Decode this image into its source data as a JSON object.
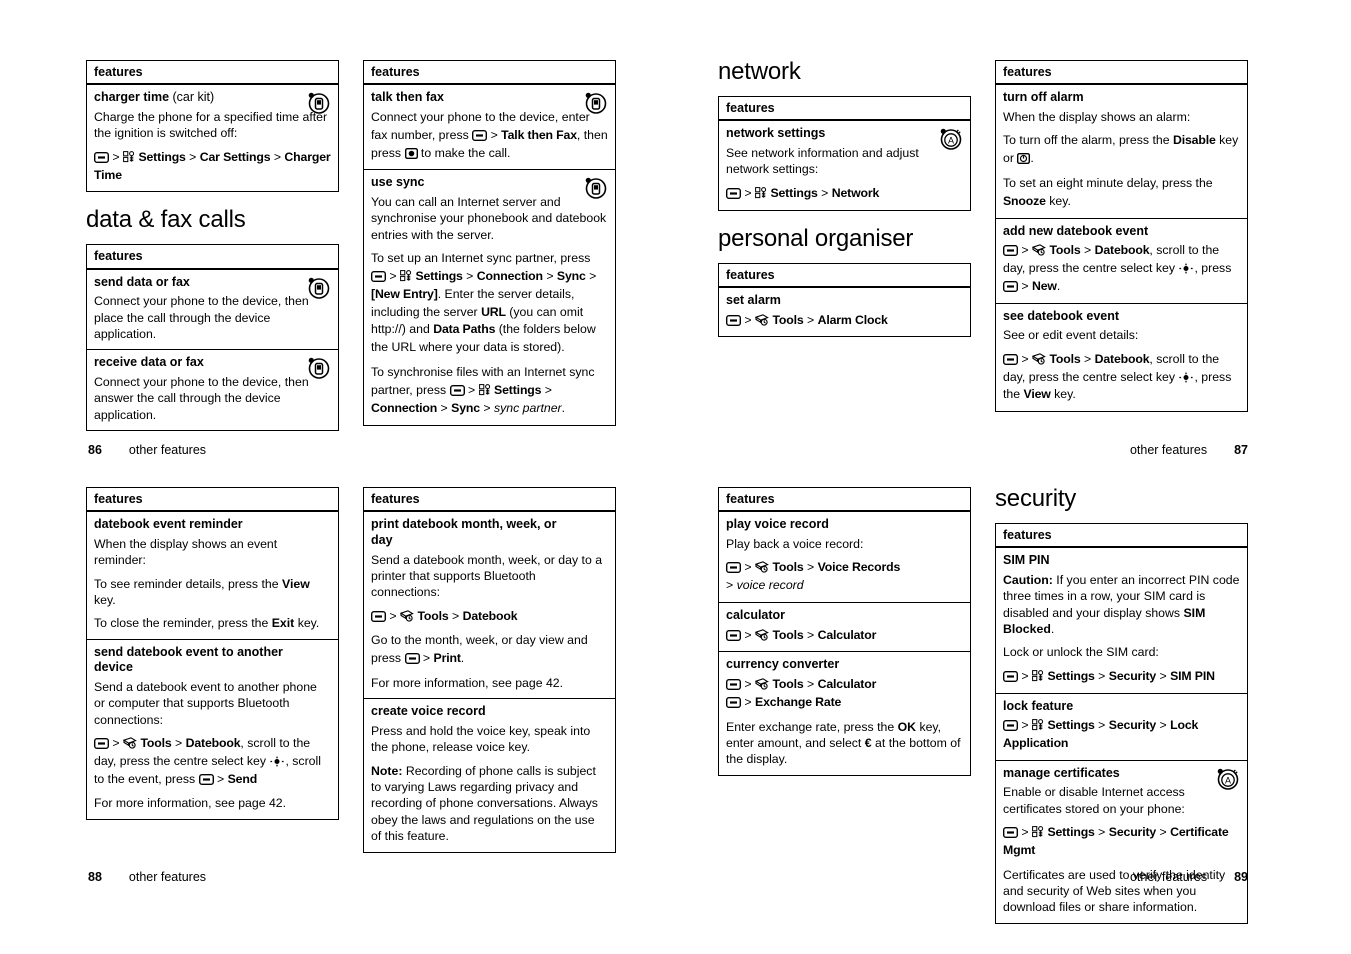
{
  "document": {
    "features_header": "features",
    "footer_label": "other features"
  },
  "pages": [
    {
      "id": "86",
      "number": "86",
      "label": "other features"
    },
    {
      "id": "87",
      "number": "87",
      "label": "other features"
    },
    {
      "id": "88",
      "number": "88",
      "label": "other features"
    },
    {
      "id": "89",
      "number": "89",
      "label": "other features"
    }
  ],
  "headings": {
    "data_fax_calls": "data & fax calls",
    "network": "network",
    "personal_organiser": "personal organiser",
    "security": "security"
  },
  "p86": {
    "table1": {
      "header": "features",
      "rows": [
        {
          "title_bold": "charger time",
          "title_plain": " (car kit)",
          "icon": "device-circle-icon",
          "body": [
            {
              "type": "para",
              "text": "Charge the phone for a specified time after the ignition is switched off:"
            },
            {
              "type": "path",
              "text": "MENUKEY > SETTINGSICON Settings > Car Settings > Charger Time"
            }
          ]
        }
      ]
    },
    "table2": {
      "header": "features",
      "rows": [
        {
          "title_bold": "send data or fax",
          "title_plain": "",
          "icon": "device-circle-icon",
          "body": [
            {
              "type": "para",
              "text": "Connect your phone to the device, then place the call through the device application."
            }
          ]
        },
        {
          "title_bold": "receive data or fax",
          "title_plain": "",
          "icon": "device-circle-icon",
          "body": [
            {
              "type": "para",
              "text": "Connect your phone to the device, then answer the call through the device application."
            }
          ]
        }
      ]
    }
  },
  "p86b": {
    "table": {
      "header": "features",
      "rows": [
        {
          "title_bold": "talk then fax",
          "icon": "device-circle-icon",
          "body_html": "Connect your phone to the device, enter fax number, press MENUKEY &gt; <b>Talk then Fax</b>, then press SENDKEY to make the call."
        },
        {
          "title_bold": "use sync",
          "icon": "device-circle-icon",
          "body_html": "You can call an Internet server and synchronise your phonebook and datebook entries with the server."
        }
      ]
    }
  },
  "p87": {
    "network_table": {
      "header": "features",
      "rows": [
        {
          "title_bold": "network settings",
          "icon": "antenna-a-circle-icon",
          "body": [
            {
              "type": "para",
              "text": "See network information and adjust network settings:"
            },
            {
              "type": "path",
              "text": "MENUKEY > SETTINGSICON Settings > Network"
            }
          ]
        }
      ]
    },
    "organiser_table": {
      "header": "features",
      "rows": [
        {
          "title_bold": "set alarm",
          "body": [
            {
              "type": "path",
              "text": "MENUKEY > TOOLSICON Tools > Alarm Clock"
            }
          ]
        }
      ]
    },
    "right_table": {
      "header": "features",
      "rows": [
        {
          "title_bold": "turn off alarm",
          "body": [
            {
              "type": "para",
              "text": "When the display shows an alarm:"
            },
            {
              "type": "para",
              "text": "To turn off the alarm, press the Disable key or POWERKEY."
            },
            {
              "type": "para",
              "text": "To set an eight minute delay, press the Snooze key."
            }
          ]
        },
        {
          "title_bold": "add new datebook event",
          "body": [
            {
              "type": "path",
              "text": "MENUKEY > TOOLSICON Tools > Datebook, scroll to the day, press the centre select key CENTREKEY, press MENUKEY > New."
            }
          ]
        },
        {
          "title_bold": "see datebook event",
          "body": [
            {
              "type": "para",
              "text": "See or edit event details:"
            },
            {
              "type": "path",
              "text": "MENUKEY > TOOLSICON Tools > Datebook, scroll to the day, press the centre select key CENTREKEY, press the View key."
            }
          ]
        }
      ]
    }
  },
  "p88": {
    "left_table": {
      "header": "features",
      "rows": [
        {
          "title_bold": "datebook event reminder",
          "body": [
            {
              "type": "para",
              "text": "When the display shows an event reminder:"
            },
            {
              "type": "para",
              "text": "To see reminder details, press the View key."
            },
            {
              "type": "para",
              "text": "To close the reminder, press the Exit key."
            }
          ]
        },
        {
          "title_bold": "send datebook event to another device",
          "body": [
            {
              "type": "para",
              "text": "Send a datebook event to another phone or computer that supports Bluetooth connections:"
            },
            {
              "type": "path",
              "text": "MENUKEY > TOOLSICON Tools > Datebook, scroll to the day, press the centre select key CENTREKEY, scroll to the event, press MENUKEY > Send"
            },
            {
              "type": "para",
              "text": "For more information, see page 42."
            }
          ]
        }
      ]
    },
    "right_table": {
      "header": "features",
      "rows": [
        {
          "title_bold": "print datebook month, week, or day",
          "body": [
            {
              "type": "para",
              "text": "Send a datebook month, week, or day to a printer that supports Bluetooth connections:"
            },
            {
              "type": "path",
              "text": "MENUKEY > TOOLSICON Tools > Datebook"
            },
            {
              "type": "para",
              "text": "Go to the month, week, or day view and press MENUKEY > Print."
            },
            {
              "type": "para",
              "text": "For more information, see page 42."
            }
          ]
        },
        {
          "title_bold": "create voice record",
          "body": [
            {
              "type": "para",
              "text": "Press and hold the voice key, speak into the phone, release voice key."
            },
            {
              "type": "para",
              "text": "Note: Recording of phone calls is subject to varying Laws regarding privacy and recording of phone conversations. Always obey the laws and regulations on the use of this feature."
            }
          ]
        }
      ]
    }
  },
  "p89": {
    "left_table": {
      "header": "features",
      "rows": [
        {
          "title_bold": "play voice record",
          "body": [
            {
              "type": "para",
              "text": "Play back a voice record:"
            },
            {
              "type": "path",
              "text": "MENUKEY > TOOLSICON Tools > Voice Records > voice record"
            }
          ]
        },
        {
          "title_bold": "calculator",
          "body": [
            {
              "type": "path",
              "text": "MENUKEY > TOOLSICON Tools > Calculator"
            }
          ]
        },
        {
          "title_bold": "currency converter",
          "body": [
            {
              "type": "path",
              "text": "MENUKEY > TOOLSICON Tools > Calculator MENUKEY > Exchange Rate"
            },
            {
              "type": "para",
              "text": "Enter exchange rate, press the OK key, enter amount, and select EUROGLYPH at the bottom of the display."
            }
          ]
        }
      ]
    },
    "right_table": {
      "header": "features",
      "rows": [
        {
          "title_bold": "SIM PIN",
          "body": [
            {
              "type": "para",
              "text": "Caution: If you enter an incorrect PIN code three times in a row, your SIM card is disabled and your display shows SIM Blocked."
            },
            {
              "type": "para",
              "text": "Lock or unlock the SIM card:"
            },
            {
              "type": "path",
              "text": "MENUKEY > SETTINGSICON Settings > Security > SIM PIN"
            }
          ]
        },
        {
          "title_bold": "lock feature",
          "body": [
            {
              "type": "path",
              "text": "MENUKEY > SETTINGSICON Settings > Security > Lock Application"
            }
          ]
        },
        {
          "title_bold": "manage certificates",
          "icon": "antenna-a-circle-icon",
          "body": [
            {
              "type": "para",
              "text": "Enable or disable Internet access certificates stored on your phone:"
            },
            {
              "type": "path",
              "text": "MENUKEY > SETTINGSICON Settings > Security > Certificate Mgmt"
            },
            {
              "type": "para",
              "text": "Certificates are used to verify the identity and security of Web sites when you download files or share information."
            }
          ]
        }
      ]
    }
  },
  "icons": {
    "menu_key": "menu-key-icon",
    "settings": "settings-gear-icon",
    "tools": "tools-icon",
    "centre_select": "centre-select-key-icon",
    "send_key": "send-key-icon",
    "power_key": "power-key-icon",
    "device_circle": "device-circle-icon",
    "antenna_a_circle": "antenna-a-circle-icon"
  }
}
